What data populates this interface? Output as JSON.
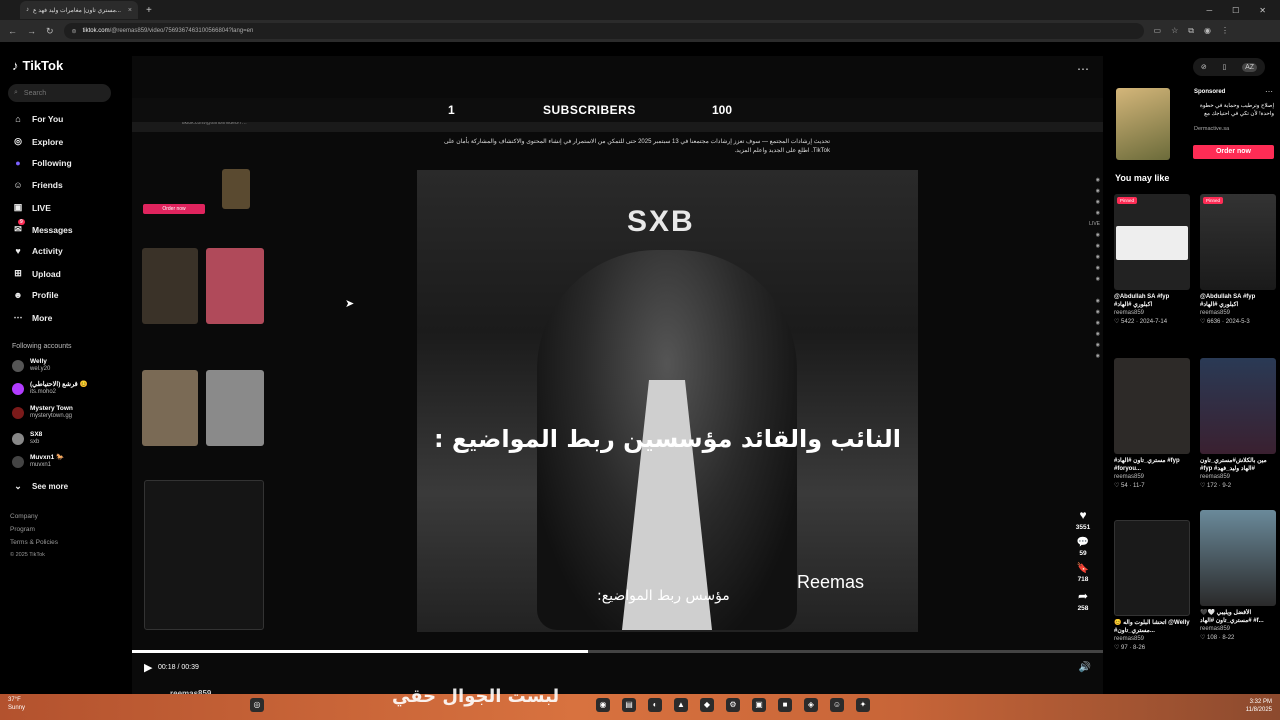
{
  "browser": {
    "tab_title": "مستري تاون| مغامرات وليد فهد ع...",
    "tab_close": "×",
    "new_tab": "+",
    "url_host": "tiktok.com",
    "url_path": "/@reemas859/video/7569367463100566804?lang=en"
  },
  "sidebar": {
    "logo": "TikTok",
    "search_placeholder": "Search",
    "items": [
      {
        "label": "For You",
        "icon": "home-icon",
        "glyph": "⌂"
      },
      {
        "label": "Explore",
        "icon": "compass-icon",
        "glyph": "◎"
      },
      {
        "label": "Following",
        "icon": "following-icon",
        "glyph": "●"
      },
      {
        "label": "Friends",
        "icon": "friends-icon",
        "glyph": "☺"
      },
      {
        "label": "LIVE",
        "icon": "live-icon",
        "glyph": "▣"
      },
      {
        "label": "Messages",
        "icon": "messages-icon",
        "glyph": "✉"
      },
      {
        "label": "Activity",
        "icon": "activity-icon",
        "glyph": "♥"
      },
      {
        "label": "Upload",
        "icon": "upload-icon",
        "glyph": "⊞"
      },
      {
        "label": "Profile",
        "icon": "profile-icon",
        "glyph": "☻"
      },
      {
        "label": "More",
        "icon": "more-icon",
        "glyph": "⋯"
      }
    ],
    "messages_badge": "9",
    "following_accounts_title": "Following accounts",
    "accounts": [
      {
        "name": "Welly",
        "handle": "wel.y20"
      },
      {
        "name": "قرشع (الاحتياطي) 😊",
        "handle": "its.moho2"
      },
      {
        "name": "Mystery Town",
        "handle": "mysterytown.gg"
      },
      {
        "name": "SX8",
        "handle": "sxb"
      },
      {
        "name": "Muvxn1 🐎",
        "handle": "muvxn1"
      }
    ],
    "see_more": "See more",
    "footer": [
      "Company",
      "Program",
      "Terms & Policies",
      "© 2025 TikTok"
    ]
  },
  "video": {
    "sub_left": "1",
    "sub_center": "SUBSCRIBERS",
    "sub_right": "100",
    "brand_logo": "SXB",
    "caption": "النائب والقائد مؤسسين ربط المواضيع :",
    "caption_small": "مؤسس ربط المواضيع:",
    "watermark": "Reemas",
    "notice": "تحديث إرشادات المجتمع — سوف تعزز إرشادات مجتمعنا في 13 سبتمبر 2025 حتى للتمكن من الاستمرار في إنشاء المحتوى والاكتشاف والمشاركة بأمان على TikTok. اطلع على الجديد واعلم المزيد.",
    "order_now_inner": "Order now",
    "current_time": "00:18 / 00:39",
    "progress": 0.47,
    "uploader": "reemas859",
    "more_options": "⋯"
  },
  "actions": [
    {
      "name": "like",
      "glyph": "♥",
      "count": "3551"
    },
    {
      "name": "comment",
      "glyph": "💬",
      "count": "59"
    },
    {
      "name": "save",
      "glyph": "🔖",
      "count": "718"
    },
    {
      "name": "share",
      "glyph": "➦",
      "count": "258"
    }
  ],
  "sponsored": {
    "label": "Sponsored",
    "text": "إصلاح وترطيب وحماية في خطوة واحدة! لأن تكي في احتياجك مع",
    "link": "Dermactive.sa",
    "button": "Order now"
  },
  "you_may_like": {
    "title": "You may like",
    "cards": [
      {
        "pinned": "Pinned",
        "title": "@Abdullah ‎SA #fyp #اكبلوري #الهاد",
        "author": "reemas859",
        "meta": "♡ 5422 · 2024-7-14"
      },
      {
        "pinned": "Pinned",
        "title": "@Abdullah ‎SA #fyp #اكبلوري #الهاد",
        "author": "reemas859",
        "meta": "♡ 6636 · 2024-5-3"
      },
      {
        "pinned": "",
        "title": "#مستري_تاون #الهاد #fyp #foryou...",
        "author": "reemas859",
        "meta": "♡ 54 · 11-7"
      },
      {
        "pinned": "",
        "title": "مين بالكلاش#مستري_تاون #fyp #الهاد وليد_فهد#",
        "author": "reemas859",
        "meta": "♡ 172 · 9-2"
      },
      {
        "pinned": "",
        "title": "😊 اتحشا البلوت واله @Welly #مستري_تاون...",
        "author": "reemas859",
        "meta": "♡ 97 · 8-26"
      },
      {
        "pinned": "",
        "title": "الأفضل ويليبي 🤍🖤 #مستري_تاون #الهاد #f...",
        "author": "reemas859",
        "meta": "♡ 108 · 8-22"
      }
    ]
  },
  "taskbar": {
    "weather_temp": "37°F",
    "weather_desc": "Sunny",
    "overlay": "لبست الجوال حقي",
    "time": "3:32 PM",
    "date": "11/8/2025"
  },
  "colors": {
    "accent": "#fe2c55",
    "bg": "#000000"
  }
}
